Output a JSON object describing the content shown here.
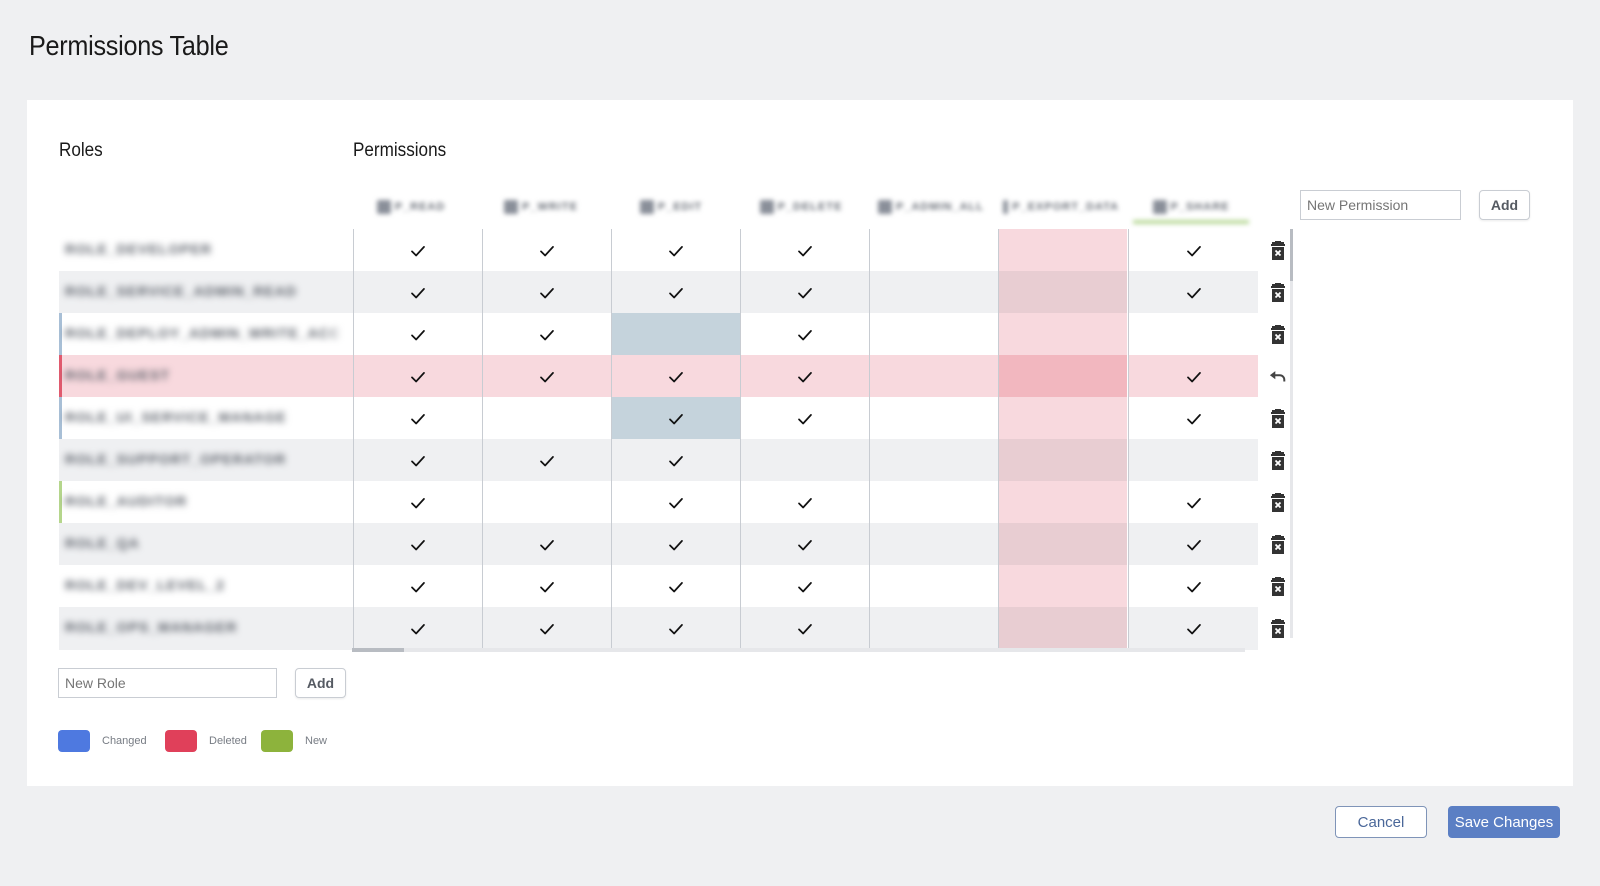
{
  "page": {
    "title": "Permissions Table"
  },
  "sections": {
    "roles": "Roles",
    "permissions": "Permissions"
  },
  "columns": [
    {
      "label": "P_READ",
      "state": "normal"
    },
    {
      "label": "P_WRITE",
      "state": "normal"
    },
    {
      "label": "P_EDIT",
      "state": "normal"
    },
    {
      "label": "P_DELETE",
      "state": "normal"
    },
    {
      "label": "P_ADMIN_ALL",
      "state": "normal"
    },
    {
      "label": "P_EXPORT_DATA",
      "state": "deleted"
    },
    {
      "label": "P_SHARE",
      "state": "new"
    }
  ],
  "rows": [
    {
      "name": "ROLE_DEVELOPER",
      "state": "normal",
      "perms": [
        1,
        1,
        1,
        1,
        0,
        0,
        1
      ],
      "changed": [],
      "action": "delete"
    },
    {
      "name": "ROLE_SERVICE_ADMIN_READ",
      "state": "normal",
      "perms": [
        1,
        1,
        1,
        1,
        0,
        0,
        1
      ],
      "changed": [],
      "action": "delete"
    },
    {
      "name": "ROLE_DEPLOY_ADMIN_WRITE_ACC",
      "state": "changed",
      "perms": [
        1,
        1,
        0,
        1,
        0,
        0,
        0
      ],
      "changed": [
        2
      ],
      "action": "delete"
    },
    {
      "name": "ROLE_GUEST",
      "state": "deleted",
      "perms": [
        1,
        1,
        1,
        1,
        0,
        0,
        1
      ],
      "changed": [],
      "action": "undo"
    },
    {
      "name": "ROLE_UI_SERVICE_MANAGE",
      "state": "changed",
      "perms": [
        1,
        0,
        1,
        1,
        0,
        0,
        1
      ],
      "changed": [
        2
      ],
      "action": "delete"
    },
    {
      "name": "ROLE_SUPPORT_OPERATOR",
      "state": "normal",
      "perms": [
        1,
        1,
        1,
        0,
        0,
        0,
        0
      ],
      "changed": [],
      "action": "delete"
    },
    {
      "name": "ROLE_AUDITOR",
      "state": "new",
      "perms": [
        1,
        0,
        1,
        1,
        0,
        0,
        1
      ],
      "changed": [],
      "action": "delete"
    },
    {
      "name": "ROLE_QA",
      "state": "normal",
      "perms": [
        1,
        1,
        1,
        1,
        0,
        0,
        1
      ],
      "changed": [],
      "action": "delete"
    },
    {
      "name": "ROLE_DEV_LEVEL_2",
      "state": "normal",
      "perms": [
        1,
        1,
        1,
        1,
        0,
        0,
        1
      ],
      "changed": [],
      "action": "delete"
    },
    {
      "name": "ROLE_OPS_MANAGER",
      "state": "normal",
      "perms": [
        1,
        1,
        1,
        1,
        0,
        0,
        1
      ],
      "changed": [],
      "action": "delete"
    }
  ],
  "new_permission": {
    "placeholder": "New Permission",
    "add_label": "Add"
  },
  "new_role": {
    "placeholder": "New Role",
    "add_label": "Add"
  },
  "legend": [
    {
      "label": "Changed",
      "color": "#4e79e0"
    },
    {
      "label": "Deleted",
      "color": "#e0405a"
    },
    {
      "label": "New",
      "color": "#8db33c"
    }
  ],
  "footer": {
    "cancel_label": "Cancel",
    "save_label": "Save Changes"
  },
  "colors": {
    "changed_mark": "#a8bfd6",
    "deleted_mark": "#e05a6e",
    "new_mark": "#b5d68c",
    "accent": "#5b7fc4"
  }
}
